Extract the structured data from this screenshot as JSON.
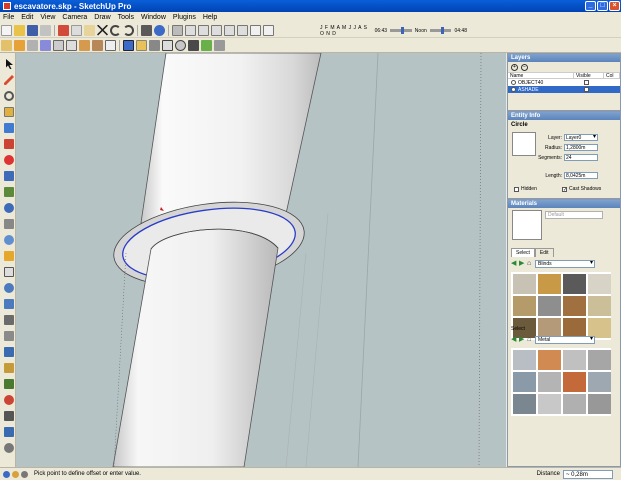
{
  "window": {
    "title": "escavatore.skp - SketchUp Pro",
    "min": "_",
    "max": "□",
    "close": "×"
  },
  "menu": [
    "File",
    "Edit",
    "View",
    "Camera",
    "Draw",
    "Tools",
    "Window",
    "Plugins",
    "Help"
  ],
  "shadow": {
    "months": "J F M A M J J A S O N D",
    "time_start": "06:43",
    "noon": "Noon",
    "time_end": "04:48"
  },
  "layers": {
    "title": "Layers",
    "add": "+",
    "remove": "−",
    "col_name": "Name",
    "col_visible": "Visible",
    "col_color": "Col",
    "rows": [
      {
        "name": "OBJECT40",
        "selected": false
      },
      {
        "name": "ASHADE",
        "selected": true
      }
    ]
  },
  "entity": {
    "title": "Entity Info",
    "type": "Circle",
    "layer_label": "Layer:",
    "layer_value": "Layer0",
    "radius_label": "Radius:",
    "radius_value": "1,2800m",
    "segments_label": "Segments:",
    "segments_value": "24",
    "length_label": "Length:",
    "length_value": "8,0425m",
    "hidden_label": "Hidden",
    "cast_label": "Cast Shadows"
  },
  "materials": {
    "title": "Materials",
    "name_value": "Default",
    "tab_select": "Select",
    "tab_edit": "Edit",
    "library_1": "Blinds",
    "select_label": "Select",
    "library_2": "Metal",
    "grid1_colors": [
      "#c8c2b4",
      "#c89a48",
      "#5a5a5a",
      "#d8d3c7",
      "#b59a6a",
      "#8e8e8e",
      "#a07040",
      "#cbbf9a",
      "#6c5a3c",
      "#b49a78",
      "#9a6a3a",
      "#d6c28a"
    ],
    "grid2_colors": [
      "#b8bec4",
      "#d08a52",
      "#c0c0c0",
      "#a6a6a6",
      "#8a9aa8",
      "#b4b4b4",
      "#c46a3a",
      "#9ea8b0",
      "#7a8690",
      "#c8c8c8",
      "#b0b0b0",
      "#989898"
    ]
  },
  "status": {
    "message": "Pick point to define offset or enter value.",
    "vcb_label": "Distance",
    "vcb_value": "~ 0,28m"
  }
}
